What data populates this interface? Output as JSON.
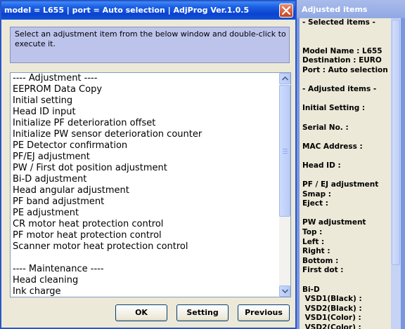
{
  "window": {
    "title": "model = L655  |  port = Auto selection  |  AdjProg Ver.1.0.5",
    "close_icon": "close-icon"
  },
  "info": {
    "text": "Select an adjustment item from the below window and double-click to execute it."
  },
  "list": {
    "items": [
      "---- Adjustment ----",
      "EEPROM Data Copy",
      "Initial setting",
      "Head ID input",
      "Initialize PF deterioration offset",
      "Initialize PW sensor deterioration counter",
      "PE Detector confirmation",
      "PF/EJ adjustment",
      "PW / First dot position adjustment",
      "Bi-D adjustment",
      "Head angular adjustment",
      "PF band adjustment",
      "PE adjustment",
      "CR motor heat protection control",
      "PF motor heat protection control",
      "Scanner motor heat protection control",
      "",
      "---- Maintenance ----",
      "Head cleaning",
      "Ink charge"
    ]
  },
  "buttons": {
    "ok": "OK",
    "setting": "Setting",
    "previous": "Previous"
  },
  "side": {
    "title": "Adjusted items",
    "lines": [
      "- Selected items -",
      "",
      "",
      "Model Name : L655",
      "Destination : EURO",
      "Port : Auto selection",
      "",
      "- Adjusted items -",
      "",
      "Initial Setting :",
      "",
      "Serial No. :",
      "",
      "MAC Address :",
      "",
      "Head ID :",
      "",
      "PF / EJ adjustment",
      "Smap :",
      "Eject :",
      "",
      "PW adjustment",
      "Top :",
      "Left :",
      "Right :",
      "Bottom :",
      "First dot :",
      "",
      "Bi-D",
      " VSD1(Black) :",
      " VSD2(Black) :",
      " VSD1(Color) :",
      " VSD2(Color) :"
    ]
  }
}
